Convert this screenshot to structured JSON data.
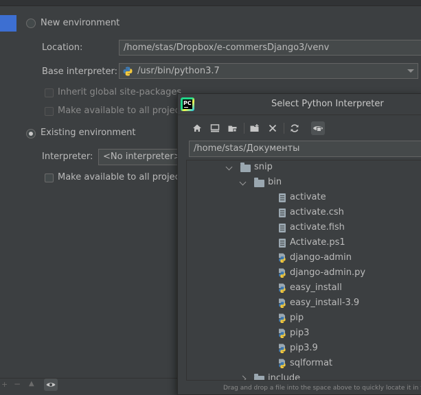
{
  "new_env": {
    "label": "New environment",
    "location_label": "Location:",
    "location_value": "/home/stas/Dropbox/e-commersDjango3/venv",
    "base_label": "Base interpreter:",
    "base_value": "/usr/bin/python3.7",
    "inherit_label": "Inherit global site-packages",
    "available_label": "Make available to all projects"
  },
  "existing_env": {
    "label": "Existing environment",
    "interpreter_label": "Interpreter:",
    "interpreter_value": "<No interpreter>",
    "available_label": "Make available to all projects"
  },
  "dialog": {
    "logo_text": "PC",
    "title": "Select Python Interpreter",
    "path": "/home/stas/Документы",
    "footer_hint": "Drag and drop a file into the space above to quickly locate it in the tre",
    "toolbar": [
      "home-icon",
      "desktop-icon",
      "project-icon",
      "new-folder-icon",
      "delete-icon",
      "refresh-icon",
      "show-hidden-icon"
    ],
    "tree": [
      {
        "name": "snip",
        "type": "folder",
        "expanded": true,
        "level": 0
      },
      {
        "name": "bin",
        "type": "folder",
        "expanded": true,
        "level": 1
      },
      {
        "name": "activate",
        "type": "file",
        "level": 2
      },
      {
        "name": "activate.csh",
        "type": "file",
        "level": 2
      },
      {
        "name": "activate.fish",
        "type": "file",
        "level": 2
      },
      {
        "name": "Activate.ps1",
        "type": "file",
        "level": 2
      },
      {
        "name": "django-admin",
        "type": "python",
        "level": 2
      },
      {
        "name": "django-admin.py",
        "type": "python",
        "level": 2
      },
      {
        "name": "easy_install",
        "type": "python",
        "level": 2
      },
      {
        "name": "easy_install-3.9",
        "type": "python",
        "level": 2
      },
      {
        "name": "pip",
        "type": "python",
        "level": 2
      },
      {
        "name": "pip3",
        "type": "python",
        "level": 2
      },
      {
        "name": "pip3.9",
        "type": "python",
        "level": 2
      },
      {
        "name": "sqlformat",
        "type": "python",
        "level": 2
      },
      {
        "name": "include",
        "type": "folder",
        "expanded": false,
        "level": 1
      }
    ]
  },
  "colors": {
    "accent": "#3d6fd2",
    "background": "#3c3f41",
    "field": "#45494a"
  }
}
